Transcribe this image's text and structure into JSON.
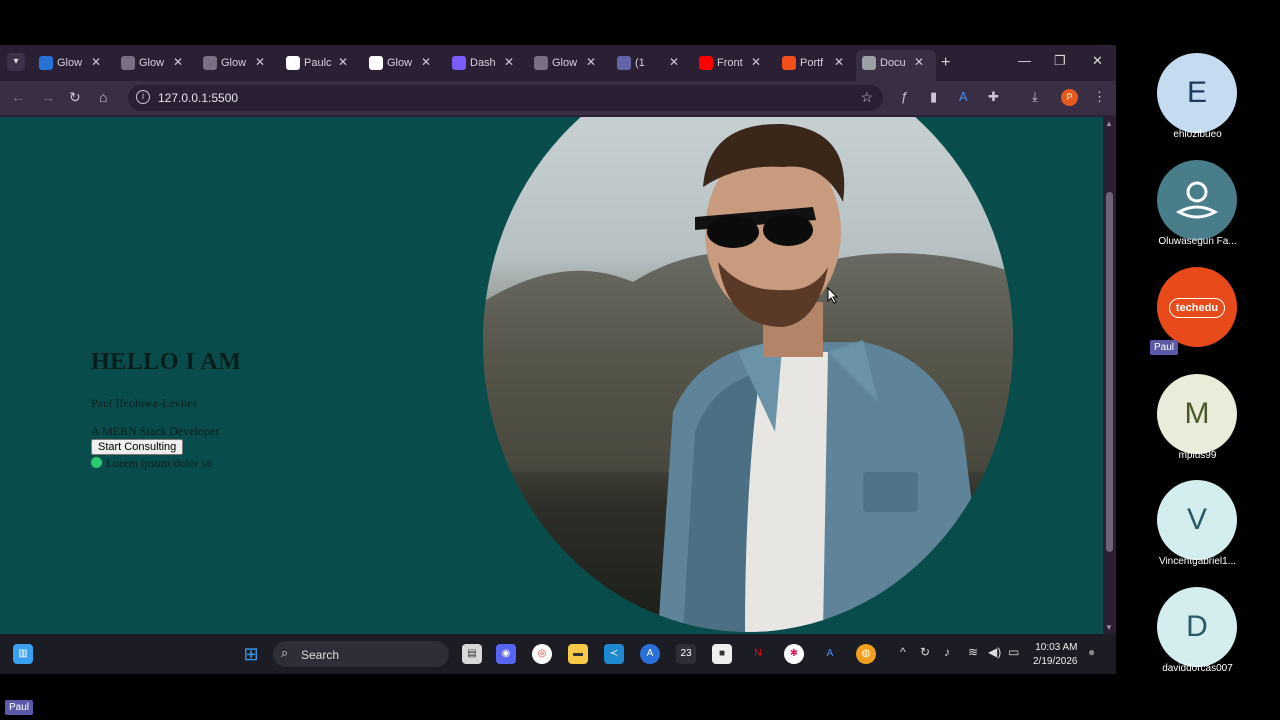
{
  "browser": {
    "tabs": [
      {
        "label": "Glow",
        "icon": "trello-icon",
        "color": "#2673d6"
      },
      {
        "label": "Glow",
        "icon": "heart-icon",
        "color": "#7b6f86"
      },
      {
        "label": "Glow",
        "icon": "heart-icon",
        "color": "#7b6f86"
      },
      {
        "label": "Paulc",
        "icon": "github-icon",
        "color": "#ffffff"
      },
      {
        "label": "Glow",
        "icon": "circle-icon",
        "color": "#ffffff"
      },
      {
        "label": "Dash",
        "icon": "dash-icon",
        "color": "#7a5cff"
      },
      {
        "label": "Glow",
        "icon": "heart-icon",
        "color": "#7b6f86"
      },
      {
        "label": "(1",
        "icon": "teams-icon",
        "color": "#6264a7"
      },
      {
        "label": "Front",
        "icon": "youtube-icon",
        "color": "#ff0000"
      },
      {
        "label": "Portf",
        "icon": "figma-icon",
        "color": "#f24e1e"
      },
      {
        "label": "Docu",
        "icon": "globe-icon",
        "color": "#9aa0a6"
      }
    ],
    "url": "127.0.0.1:5500",
    "profile_initial": "P"
  },
  "page": {
    "title": "HELLO I AM",
    "name": "Paul Ifeoluwa-Levites",
    "role": "A MERN Stack Developer",
    "cta_label": "Start Consulting",
    "status_text": "Lorem ipsum dolor sit",
    "background_color": "#084d4b",
    "status_dot_color": "#2bcb6f"
  },
  "taskbar": {
    "search_label": "Search",
    "badge": "23",
    "time": "10:03 AM",
    "date": "2/19/2026"
  },
  "participants": [
    {
      "initial": "E",
      "name": "ehiozibueo",
      "bg": "#c5dcf0",
      "fg": "#1e3a5f"
    },
    {
      "initial": "",
      "name": "Oluwasegun Fa...",
      "bg": "#4a7d8a",
      "fg": "#ffffff"
    },
    {
      "initial": "",
      "name": "",
      "bg": "#e84a1a",
      "fg": "#ffffff"
    },
    {
      "initial": "M",
      "name": "mpius99",
      "bg": "#e8ecd8",
      "fg": "#4a5a2a"
    },
    {
      "initial": "V",
      "name": "Vincentgabriel1...",
      "bg": "#d4eef0",
      "fg": "#2a5a66"
    },
    {
      "initial": "D",
      "name": "daviddorcas007",
      "bg": "#d4eef0",
      "fg": "#2a5a66"
    }
  ],
  "logo_text": "techedu",
  "tags": {
    "speaker": "Paul",
    "self": "Paul"
  }
}
